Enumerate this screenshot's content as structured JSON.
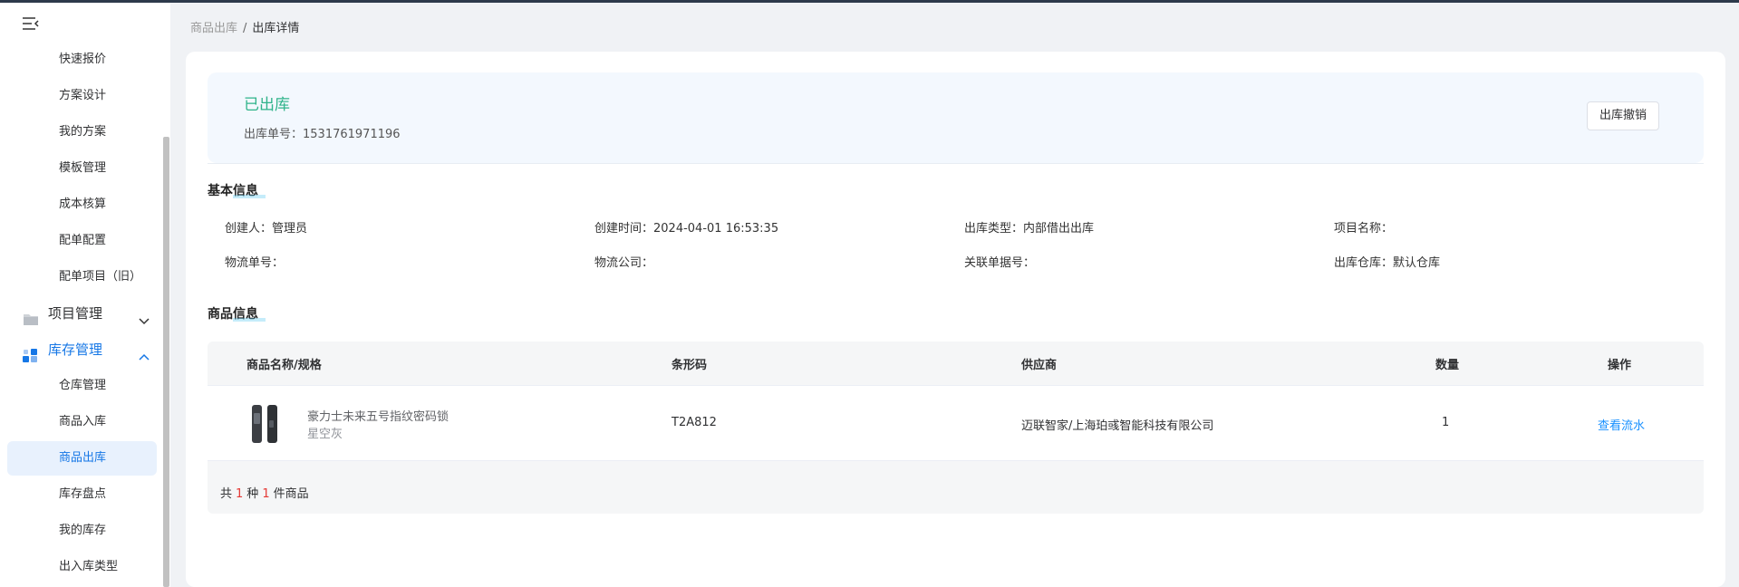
{
  "sidebar": {
    "toggle_icon": "menu-fold-icon",
    "sub_items_top": [
      "快速报价",
      "方案设计",
      "我的方案",
      "模板管理",
      "成本核算",
      "配单配置",
      "配单项目（旧）"
    ],
    "groups": [
      {
        "label": "项目管理",
        "icon": "folder-icon",
        "expanded": false
      },
      {
        "label": "库存管理",
        "icon": "grid-icon",
        "expanded": true
      }
    ],
    "inventory_items": [
      "仓库管理",
      "商品入库",
      "商品出库",
      "库存盘点",
      "我的库存",
      "出入库类型"
    ],
    "active_item": "商品出库"
  },
  "breadcrumb": {
    "parent": "商品出库",
    "separator": "/",
    "current": "出库详情"
  },
  "status": {
    "title": "已出库",
    "order_label": "出库单号：",
    "order_no": "1531761971196",
    "revoke_button": "出库撤销"
  },
  "basic_info": {
    "title": "基本信息",
    "fields": [
      {
        "label": "创建人：",
        "value": "管理员"
      },
      {
        "label": "创建时间：",
        "value": "2024-04-01 16:53:35"
      },
      {
        "label": "出库类型：",
        "value": "内部借出出库"
      },
      {
        "label": "项目名称：",
        "value": ""
      },
      {
        "label": "物流单号：",
        "value": ""
      },
      {
        "label": "物流公司：",
        "value": ""
      },
      {
        "label": "关联单据号：",
        "value": ""
      },
      {
        "label": "出库仓库：",
        "value": "默认仓库"
      }
    ]
  },
  "goods": {
    "title": "商品信息",
    "columns": [
      "商品名称/规格",
      "条形码",
      "供应商",
      "数量",
      "操作"
    ],
    "rows": [
      {
        "name": "豪力士未来五号指纹密码锁",
        "spec": "星空灰",
        "barcode": "T2A812",
        "supplier": "迈联智家/上海珀彧智能科技有限公司",
        "qty": "1",
        "action": "查看流水"
      }
    ],
    "summary": {
      "prefix": "共",
      "kinds": "1",
      "mid": "种",
      "count": "1",
      "suffix": "件商品"
    }
  },
  "colors": {
    "accent": "#1677e6",
    "status_green": "#2fb38a",
    "link": "#1890ff",
    "highlight_red": "#e53935"
  }
}
